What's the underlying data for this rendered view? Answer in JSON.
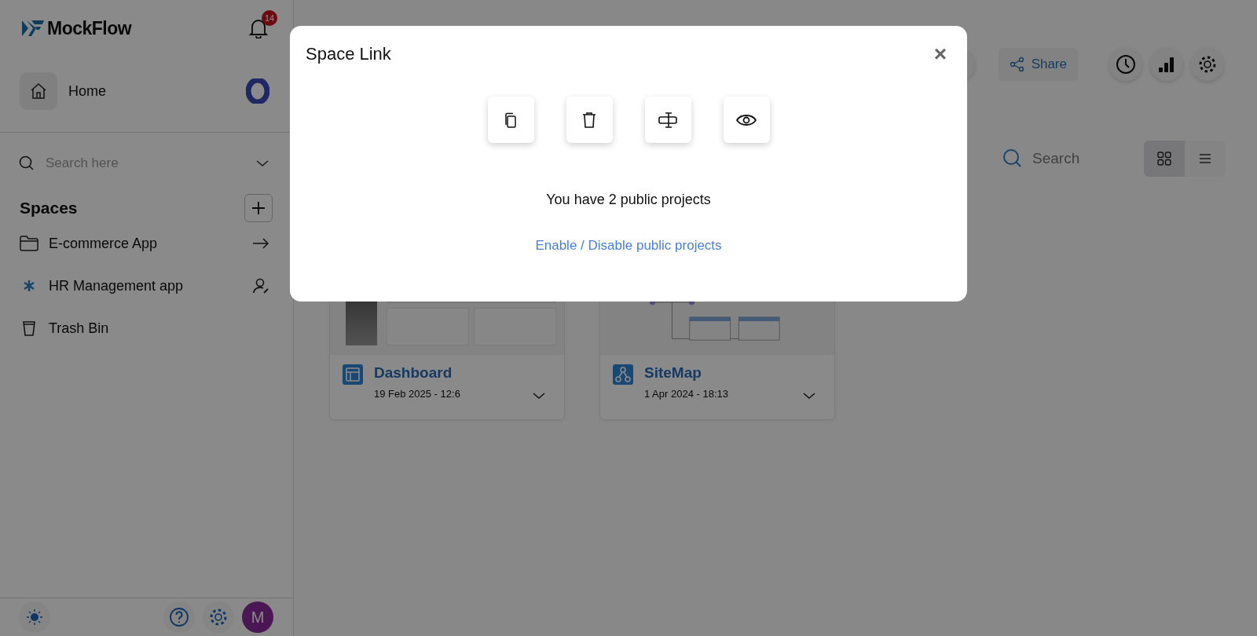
{
  "sidebar": {
    "logo": "MockFlow",
    "notification_count": "14",
    "home": {
      "label": "Home"
    },
    "search": {
      "placeholder": "Search here"
    },
    "spaces_title": "Spaces",
    "spaces": [
      {
        "label": "E-commerce App",
        "kind": "folder"
      },
      {
        "label": "HR Management app",
        "kind": "shared"
      },
      {
        "label": "Trash Bin",
        "kind": "trash"
      }
    ],
    "avatar": "M"
  },
  "toolbar": {
    "share": "Share"
  },
  "search": {
    "placeholder": "Search"
  },
  "view_toggle": [
    {
      "kind": "grid",
      "selected": true
    },
    {
      "kind": "list",
      "selected": false
    }
  ],
  "projects": [
    {
      "title": "Dashboard",
      "date": "19 Feb 2025 - 12:6",
      "kind": "dashboard"
    },
    {
      "title": "SiteMap",
      "date": "1 Apr 2024 - 18:13",
      "kind": "sitemap"
    }
  ],
  "modal": {
    "title": "Space Link",
    "close": "×",
    "message": "You have 2 public projects",
    "link": "Enable / Disable public projects"
  }
}
